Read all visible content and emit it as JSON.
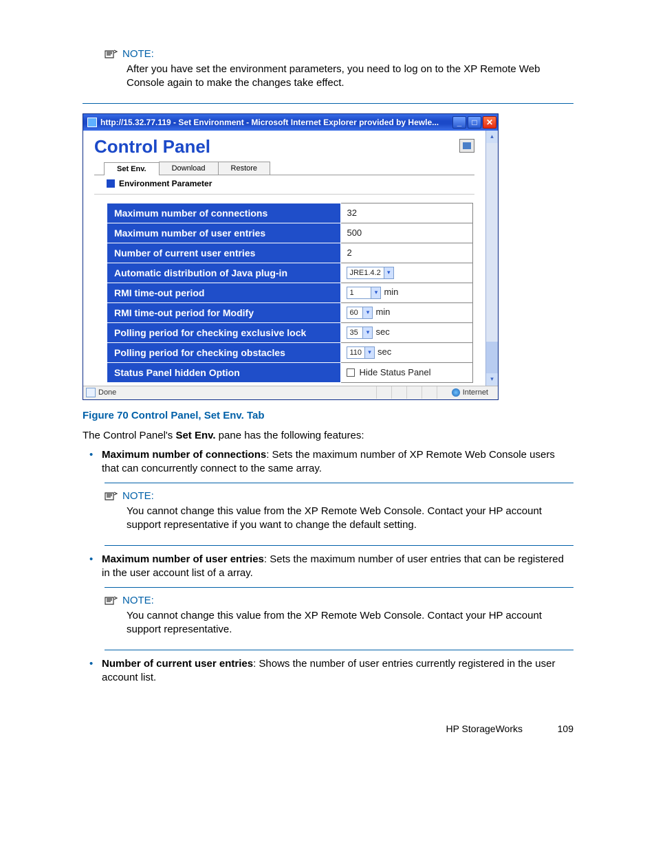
{
  "notes": {
    "label": "NOTE:",
    "intro": "After you have set the environment parameters, you need to log on to the XP Remote Web Console again to make the changes take effect.",
    "n1": "You cannot change this value from the XP Remote Web Console. Contact your HP account support representative if you want to change the default setting.",
    "n2": "You cannot change this value from the XP Remote Web Console. Contact your HP account support representative."
  },
  "ie": {
    "title": "http://15.32.77.119 - Set Environment - Microsoft Internet Explorer provided by Hewle...",
    "cp_title": "Control Panel",
    "tabs": {
      "set_env": "Set Env.",
      "download": "Download",
      "restore": "Restore"
    },
    "env_param": "Environment Parameter",
    "rows": {
      "r1k": "Maximum number of connections",
      "r1v": "32",
      "r2k": "Maximum number of user entries",
      "r2v": "500",
      "r3k": "Number of current user entries",
      "r3v": "2",
      "r4k": "Automatic distribution of Java plug-in",
      "r4v": "JRE1.4.2",
      "r5k": "RMI time-out period",
      "r5v": "1",
      "r5u": "min",
      "r6k": "RMI time-out period for Modify",
      "r6v": "60",
      "r6u": "min",
      "r7k": "Polling period for checking exclusive lock",
      "r7v": "35",
      "r7u": "sec",
      "r8k": "Polling period for checking obstacles",
      "r8v": "110",
      "r8u": "sec",
      "r9k": "Status Panel hidden Option",
      "r9v": "Hide Status Panel"
    },
    "status_done": "Done",
    "status_zone": "Internet"
  },
  "fig_caption": "Figure 70 Control Panel, Set Env. Tab",
  "intro_line_a": "The Control Panel's ",
  "intro_bold": "Set Env.",
  "intro_line_b": " pane has the following features:",
  "bul": {
    "b1_bold": "Maximum number of connections",
    "b1_rest": ": Sets the maximum number of XP Remote Web Console users that can concurrently connect to the same array.",
    "b2_bold": "Maximum number of user entries",
    "b2_rest": ": Sets the maximum number of user entries that can be registered in the user account list of a array.",
    "b3_bold": "Number of current user entries",
    "b3_rest": ": Shows the number of user entries currently registered in the user account list."
  },
  "footer": {
    "brand": "HP StorageWorks",
    "page": "109"
  }
}
